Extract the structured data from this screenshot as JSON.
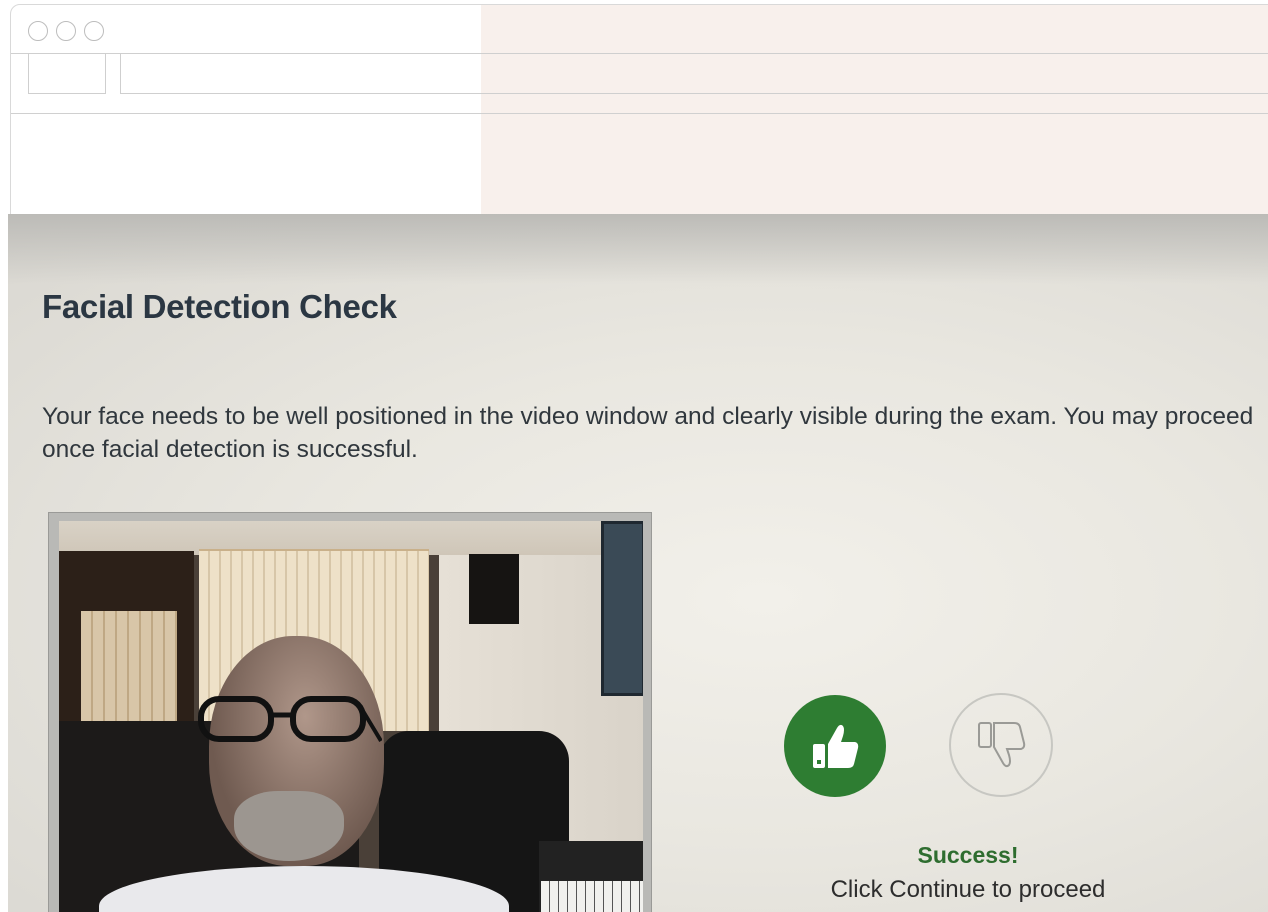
{
  "page": {
    "title": "Facial Detection Check",
    "description": "Your face needs to be well positioned in the video window and clearly visible during the exam. You may proceed once facial detection is successful."
  },
  "status": {
    "title": "Success!",
    "message": "Click Continue to proceed",
    "selected": "thumbs-up"
  },
  "icons": {
    "approve": "thumbs-up-icon",
    "reject": "thumbs-down-icon"
  },
  "colors": {
    "success_green": "#2e7d32",
    "title_text": "#2b3743",
    "success_text": "#2e6d2f"
  }
}
